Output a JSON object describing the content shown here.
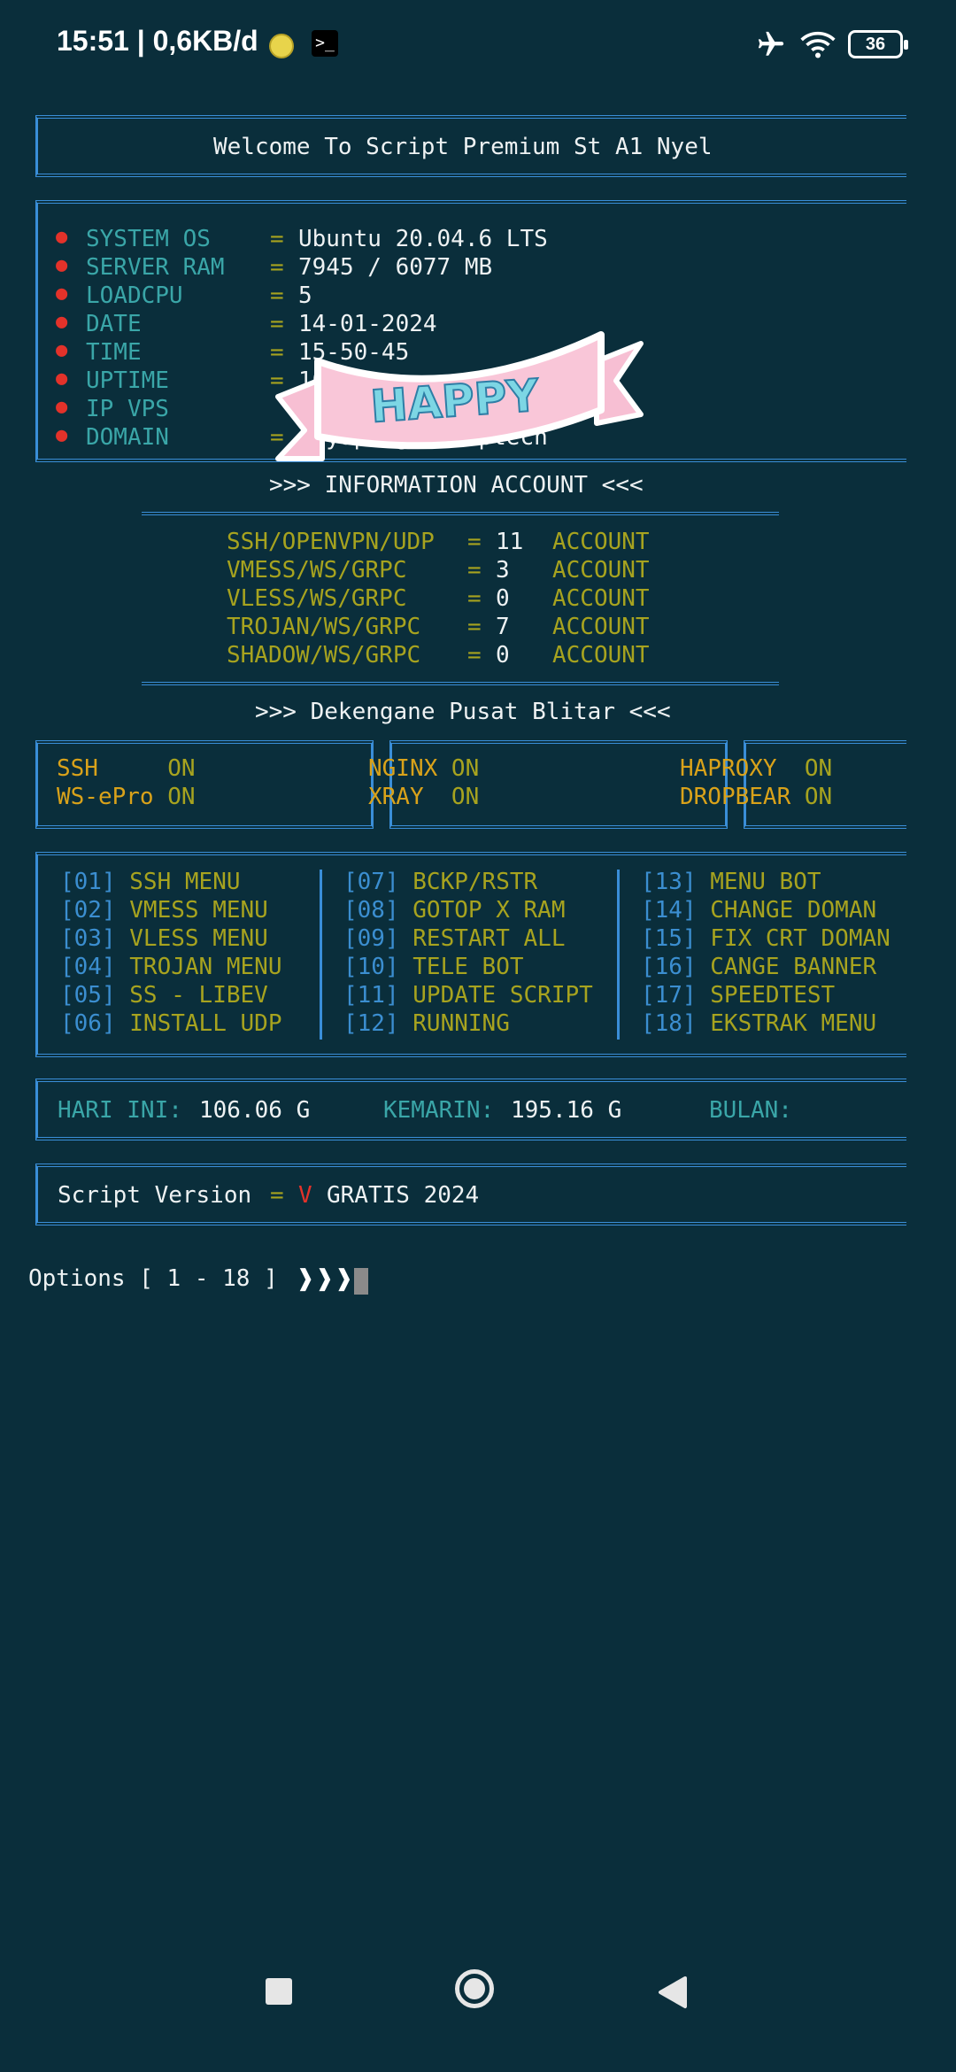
{
  "status_bar": {
    "time": "15:51 | 0,6KB/d",
    "battery": "36",
    "icons": [
      "coin-icon",
      "terminal-icon",
      "airplane-icon",
      "wifi-icon",
      "battery-icon"
    ]
  },
  "welcome": "Welcome To Script Premium St A1 Nyel",
  "sysinfo": [
    {
      "label": "SYSTEM OS  ",
      "eq": "=",
      "value": "Ubuntu 20.04.6 LTS"
    },
    {
      "label": "SERVER RAM ",
      "eq": "=",
      "value": "7945 / 6077 MB"
    },
    {
      "label": "LOADCPU    ",
      "eq": "=",
      "value": "5"
    },
    {
      "label": "DATE       ",
      "eq": "=",
      "value": "14-01-2024"
    },
    {
      "label": "TIME       ",
      "eq": "=",
      "value": "15-50-45"
    },
    {
      "label": "UPTIME     ",
      "eq": "=",
      "value": "10"
    },
    {
      "label": "IP VPS     ",
      "eq": "",
      "value": ""
    },
    {
      "label": "DOMAIN     ",
      "eq": "=",
      "value": "aryaprog     ptech"
    }
  ],
  "sticker": {
    "text": "HAPPY"
  },
  "info_account_header": ">>> INFORMATION ACCOUNT <<<",
  "accounts": [
    {
      "label": "SSH/OPENVPN/UDP  ",
      "eq": "=",
      "count": "11",
      "suffix": "ACCOUNT"
    },
    {
      "label": "VMESS/WS/GRPC    ",
      "eq": "=",
      "count": "3 ",
      "suffix": "ACCOUNT"
    },
    {
      "label": "VLESS/WS/GRPC    ",
      "eq": "=",
      "count": "0 ",
      "suffix": "ACCOUNT"
    },
    {
      "label": "TROJAN/WS/GRPC   ",
      "eq": "=",
      "count": "7 ",
      "suffix": "ACCOUNT"
    },
    {
      "label": "SHADOW/WS/GRPC   ",
      "eq": "=",
      "count": "0 ",
      "suffix": "ACCOUNT"
    }
  ],
  "pusat_header": ">>> Dekengane Pusat Blitar <<<",
  "services": [
    {
      "name": "SSH     ",
      "state": "ON"
    },
    {
      "name": "WS-ePro ",
      "state": "ON"
    },
    {
      "name": "NGINX ",
      "state": "ON"
    },
    {
      "name": "XRAY  ",
      "state": "ON"
    },
    {
      "name": "HAPROXY  ",
      "state": "ON"
    },
    {
      "name": "DROPBEAR ",
      "state": "ON"
    }
  ],
  "menu": [
    [
      {
        "num": "[01]",
        "label": "SSH MENU"
      },
      {
        "num": "[02]",
        "label": "VMESS MENU"
      },
      {
        "num": "[03]",
        "label": "VLESS MENU"
      },
      {
        "num": "[04]",
        "label": "TROJAN MENU"
      },
      {
        "num": "[05]",
        "label": "SS - LIBEV"
      },
      {
        "num": "[06]",
        "label": "INSTALL UDP"
      }
    ],
    [
      {
        "num": "[07]",
        "label": "BCKP/RSTR"
      },
      {
        "num": "[08]",
        "label": "GOTOP X RAM"
      },
      {
        "num": "[09]",
        "label": "RESTART ALL"
      },
      {
        "num": "[10]",
        "label": "TELE BOT"
      },
      {
        "num": "[11]",
        "label": "UPDATE SCRIPT"
      },
      {
        "num": "[12]",
        "label": "RUNNING"
      }
    ],
    [
      {
        "num": "[13]",
        "label": "MENU BOT"
      },
      {
        "num": "[14]",
        "label": "CHANGE DOMAN"
      },
      {
        "num": "[15]",
        "label": "FIX CRT DOMAN"
      },
      {
        "num": "[16]",
        "label": "CANGE BANNER"
      },
      {
        "num": "[17]",
        "label": "SPEEDTEST"
      },
      {
        "num": "[18]",
        "label": "EKSTRAK MENU"
      }
    ]
  ],
  "bandwidth": {
    "today_label": "HARI INI:",
    "today_value": "106.06 G",
    "yesterday_label": "KEMARIN:",
    "yesterday_value": "195.16 G",
    "month_label": "BULAN:",
    "month_value": ""
  },
  "version": {
    "label": "Script Version",
    "eq": "=",
    "v": "V",
    "value": "GRATIS 2024"
  },
  "prompt": {
    "text": "Options [ 1 - 18 ]",
    "arrows": "❱❱❱"
  },
  "nav": {
    "icons": [
      "recents-square-icon",
      "home-circle-icon",
      "back-triangle-icon"
    ]
  }
}
